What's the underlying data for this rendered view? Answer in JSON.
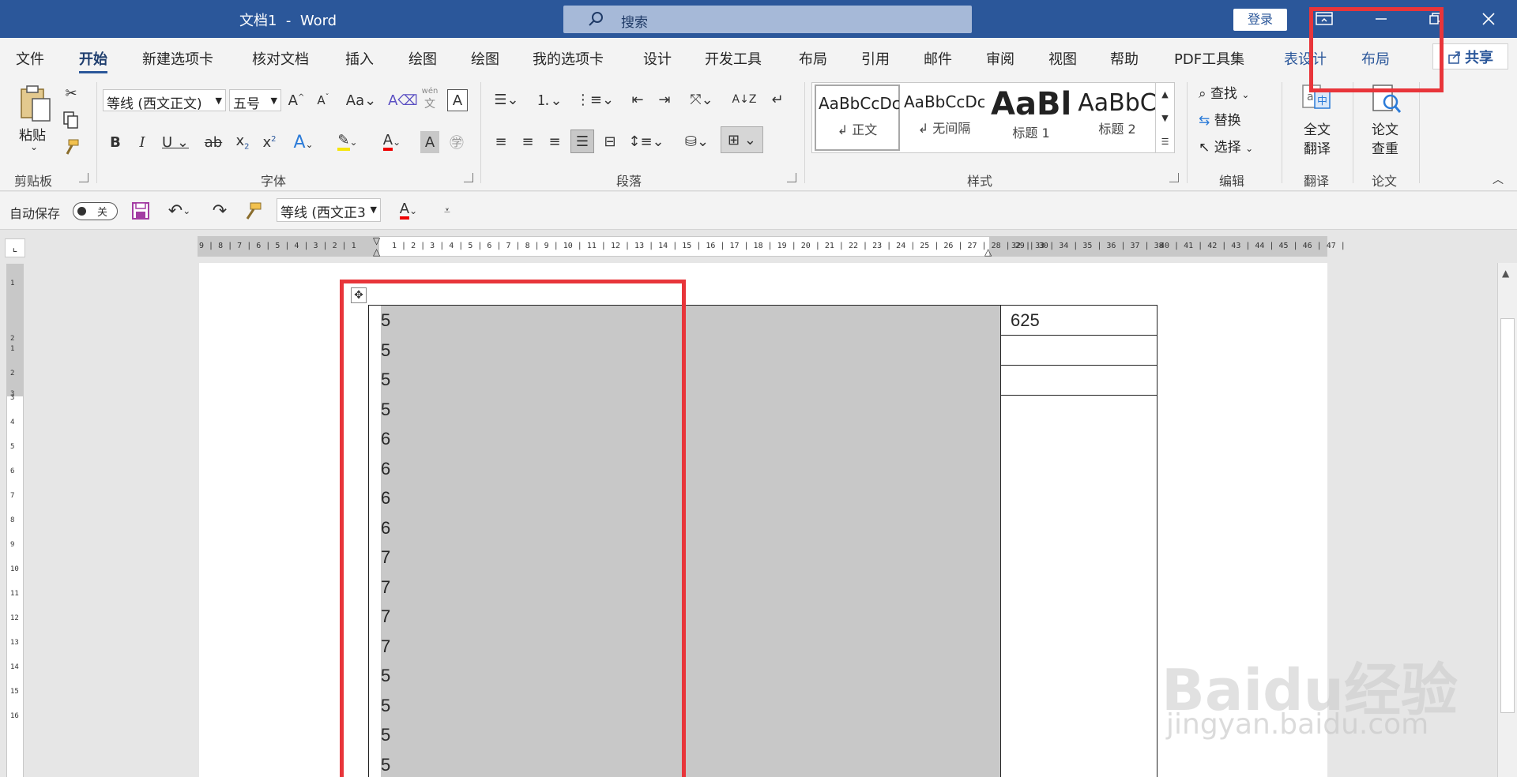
{
  "titlebar": {
    "title": "文档1  -  Word",
    "search_placeholder": "搜索",
    "login_label": "登录"
  },
  "tabs": [
    {
      "label": "文件"
    },
    {
      "label": "开始"
    },
    {
      "label": "新建选项卡"
    },
    {
      "label": "核对文档"
    },
    {
      "label": "插入"
    },
    {
      "label": "绘图"
    },
    {
      "label": "绘图"
    },
    {
      "label": "我的选项卡"
    },
    {
      "label": "设计"
    },
    {
      "label": "开发工具"
    },
    {
      "label": "布局"
    },
    {
      "label": "引用"
    },
    {
      "label": "邮件"
    },
    {
      "label": "审阅"
    },
    {
      "label": "视图"
    },
    {
      "label": "帮助"
    },
    {
      "label": "PDF工具集"
    },
    {
      "label": "表设计"
    },
    {
      "label": "布局"
    }
  ],
  "share_label": "共享",
  "ribbon": {
    "clipboard": {
      "paste": "粘贴",
      "group": "剪贴板"
    },
    "font": {
      "font_name": "等线 (西文正文)",
      "font_size": "五号",
      "group": "字体",
      "phonetic": "wén"
    },
    "paragraph": {
      "group": "段落"
    },
    "styles": {
      "group": "样式",
      "items": [
        {
          "preview": "AaBbCcDc",
          "name": "↲ 正文"
        },
        {
          "preview": "AaBbCcDc",
          "name": "↲ 无间隔"
        },
        {
          "preview": "AaBl",
          "name": "标题 1"
        },
        {
          "preview": "AaBbC",
          "name": "标题 2"
        }
      ]
    },
    "editing": {
      "find": "查找",
      "replace": "替换",
      "select": "选择",
      "group": "编辑"
    },
    "translate": {
      "label1": "全文",
      "label2": "翻译",
      "group": "翻译"
    },
    "paper": {
      "label1": "论文",
      "label2": "查重",
      "group": "论文"
    }
  },
  "qat": {
    "autosave_label": "自动保存",
    "autosave_state": "关",
    "font_name": "等线 (西文正3"
  },
  "ruler": {
    "left_numbers": "9 | 8 | 7 | 6 | 5 | 4 | 3 | 2 | 1",
    "right_numbers": "1 | 2 | 3 | 4 | 5 | 6 | 7 | 8 | 9 | 10 | 11 | 12 | 13 | 14 | 15 | 16 | 17 | 18 | 19 | 20 | 21 | 22 | 23 | 24 | 25 | 26 | 27 | 28 | 29 | 30",
    "far_numbers": "32 | 33 | 34 | 35 | 36 | 37 | 38",
    "far2_numbers": "40 | 41 | 42 | 43 | 44 | 45 | 46 | 47 |",
    "vertical_numbers": [
      "1",
      "2",
      "3",
      "1",
      "2",
      "3",
      "4",
      "5",
      "6",
      "7",
      "8",
      "9",
      "10",
      "11",
      "12",
      "13",
      "14",
      "15",
      "16"
    ]
  },
  "table": {
    "col1_values": [
      "5",
      "5",
      "5",
      "5",
      "6",
      "6",
      "6",
      "6",
      "7",
      "7",
      "7",
      "7",
      "5",
      "5",
      "5",
      "5"
    ],
    "col2_values": [
      "625",
      "",
      ""
    ]
  },
  "watermark": {
    "logo": "Baidu经验",
    "url": "jingyan.baidu.com"
  },
  "colors": {
    "title_bar": "#2b579a",
    "annotation_red": "#e8353a",
    "selection_gray": "#c8c8c8"
  }
}
